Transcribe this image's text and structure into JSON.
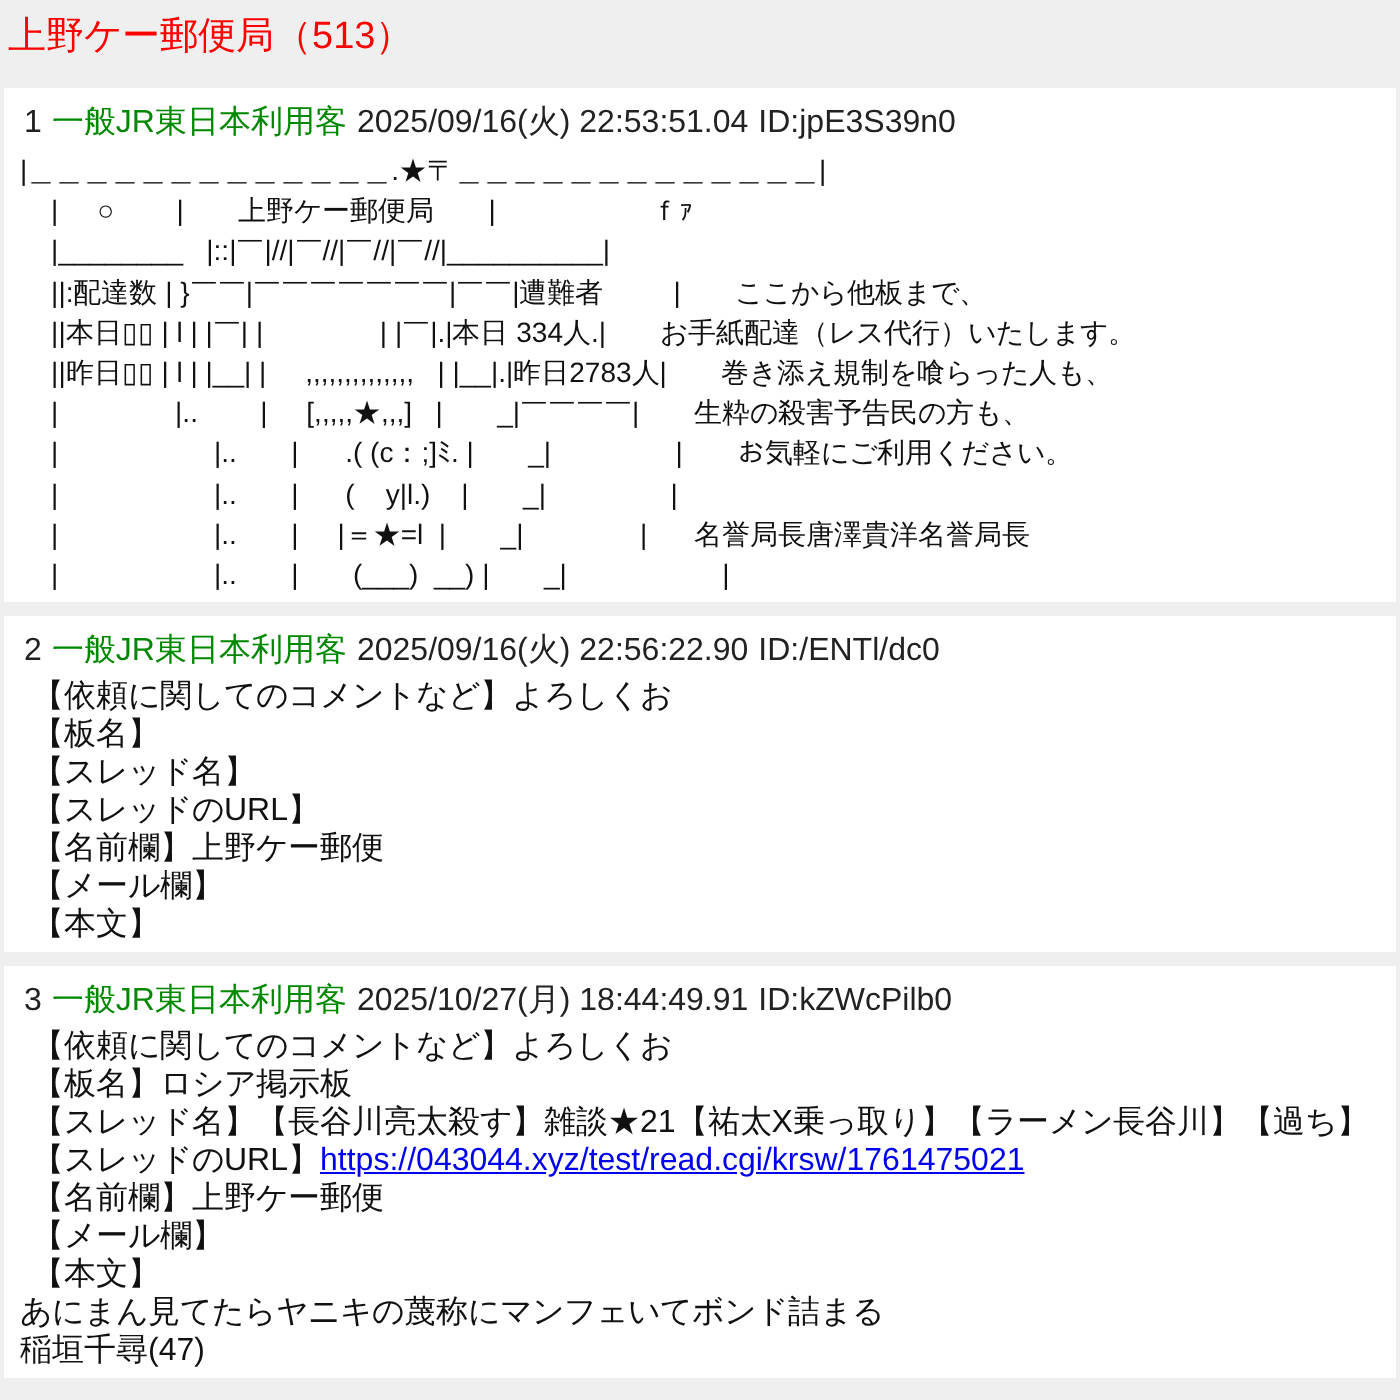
{
  "thread": {
    "title": "上野ケー郵便局（513）"
  },
  "posts": [
    {
      "kind": "art",
      "number": "1",
      "name": "一般JR東日本利用客",
      "date": "2025/09/16(火) 22:53:51.04",
      "id": "ID:jpE3S39n0",
      "lines": [
        {
          "text": "|＿＿＿＿＿＿＿＿＿＿＿＿＿.★〒＿＿＿＿＿＿＿＿＿＿＿＿＿|"
        },
        {
          "text": "    |     ○        |       上野ケー郵便局       |                    ｆｧ"
        },
        {
          "text": "    |________   |::|￣|//|￣//|￣//|￣//|__________|"
        },
        {
          "text": "    ||:配達数 | }￣￣|￣￣￣￣￣￣￣|￣￣|遭難者         |       ここから他板まで、"
        },
        {
          "text": "    ||本日▯▯ | l | |￣| |               | |￣|.|本日 334人.|       お手紙配達（レス代行）いたします。"
        },
        {
          "text": "    ||昨日▯▯ | l | |__| |     ,,,,,,,,,,,,,,   | |__|.|昨日2783人|       巻き添え規制を喰らった人も、"
        },
        {
          "text": "    |               |..        |     [,,,,,★,,,]   |       _|￣￣￣￣|       生粋の殺害予告民の方も、"
        },
        {
          "text": "    |                    |..       |      .( (c：;]ﾐ. |       _|                |       お気軽にご利用ください。"
        },
        {
          "text": "    |                    |..       |      (    y|l.)    |       _|                |"
        },
        {
          "text": "    |                    |..       |     |＝★=l  |       _|               |      名誉局長唐澤貴洋名誉局長"
        },
        {
          "text": "    |                    |..       |       (___)  __) |       _|                    |"
        }
      ]
    },
    {
      "kind": "text",
      "number": "2",
      "name": "一般JR東日本利用客",
      "date": "2025/09/16(火) 22:56:22.90",
      "id": "ID:/ENTl/dc0",
      "lines": [
        {
          "text": "【依頼に関してのコメントなど】よろしくお"
        },
        {
          "text": "【板名】"
        },
        {
          "text": "【スレッド名】"
        },
        {
          "text": "【スレッドのURL】"
        },
        {
          "text": "【名前欄】上野ケー郵便"
        },
        {
          "text": "【メール欄】"
        },
        {
          "text": "【本文】"
        }
      ]
    },
    {
      "kind": "text",
      "number": "3",
      "name": "一般JR東日本利用客",
      "date": "2025/10/27(月) 18:44:49.91",
      "id": "ID:kZWcPilb0",
      "lines": [
        {
          "text": "【依頼に関してのコメントなど】よろしくお"
        },
        {
          "text": "【板名】ロシア掲示板"
        },
        {
          "text": "【スレッド名】【長谷川亮太殺す】雑談★21【祐太X乗っ取り】【ラーメン長谷川】【過ち】"
        },
        {
          "text": "【スレッドのURL】",
          "link": "https://043044.xyz/test/read.cgi/krsw/1761475021"
        },
        {
          "text": "【名前欄】上野ケー郵便"
        },
        {
          "text": "【メール欄】"
        },
        {
          "text": "【本文】"
        },
        {
          "text": "あにまん見てたらヤニキの蔑称にマンフェいてボンド詰まる",
          "flush": true
        },
        {
          "text": "稲垣千尋(47)",
          "flush": true
        }
      ]
    }
  ]
}
